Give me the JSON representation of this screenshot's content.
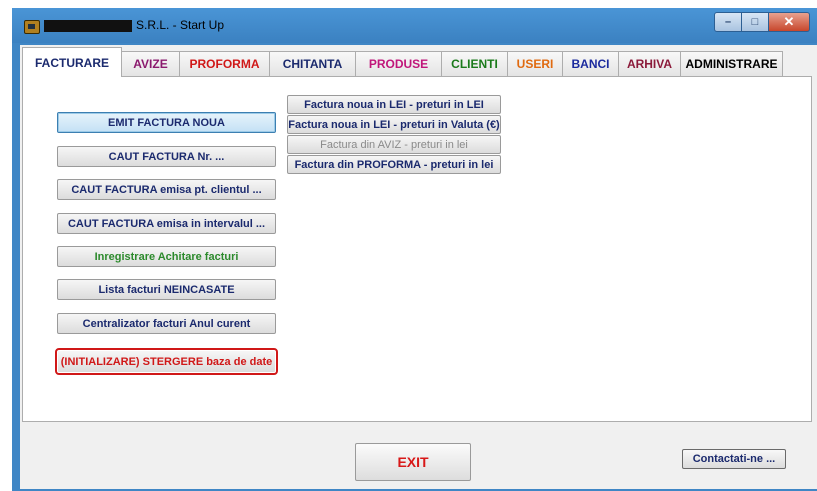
{
  "window": {
    "title": "S.R.L. - Start Up",
    "minimize_label": "–",
    "maximize_label": "□",
    "close_label": "✕"
  },
  "tabs": [
    {
      "label": "FACTURARE",
      "color": "#1b2a6e",
      "active": true
    },
    {
      "label": "AVIZE",
      "color": "#8b1a6e"
    },
    {
      "label": "PROFORMA",
      "color": "#d01818"
    },
    {
      "label": "CHITANTA",
      "color": "#1b2a6e"
    },
    {
      "label": "PRODUSE",
      "color": "#c0167a"
    },
    {
      "label": "CLIENTI",
      "color": "#1a7a1a"
    },
    {
      "label": "USERI",
      "color": "#e06a10"
    },
    {
      "label": "BANCI",
      "color": "#1b2a9e"
    },
    {
      "label": "ARHIVA",
      "color": "#8b1a3a"
    },
    {
      "label": "ADMINISTRARE",
      "color": "#000000"
    }
  ],
  "left_buttons": [
    {
      "label": "EMIT FACTURA NOUA"
    },
    {
      "label": "CAUT  FACTURA Nr. ..."
    },
    {
      "label": "CAUT FACTURA emisa pt. clientul ..."
    },
    {
      "label": "CAUT FACTURA emisa in intervalul ..."
    },
    {
      "label": "Inregistrare Achitare facturi"
    },
    {
      "label": "Lista facturi NEINCASATE"
    },
    {
      "label": "Centralizator facturi Anul curent"
    },
    {
      "label": "(INITIALIZARE) STERGERE baza de date"
    }
  ],
  "right_buttons": [
    {
      "label": "Factura noua in LEI - preturi in LEI"
    },
    {
      "label": "Factura noua in LEI - preturi in Valuta (€)"
    },
    {
      "label": "Factura din AVIZ - preturi in lei"
    },
    {
      "label": "Factura din PROFORMA - preturi in  lei"
    }
  ],
  "footer": {
    "exit_label": "EXIT",
    "contact_label": "Contactati-ne ..."
  }
}
